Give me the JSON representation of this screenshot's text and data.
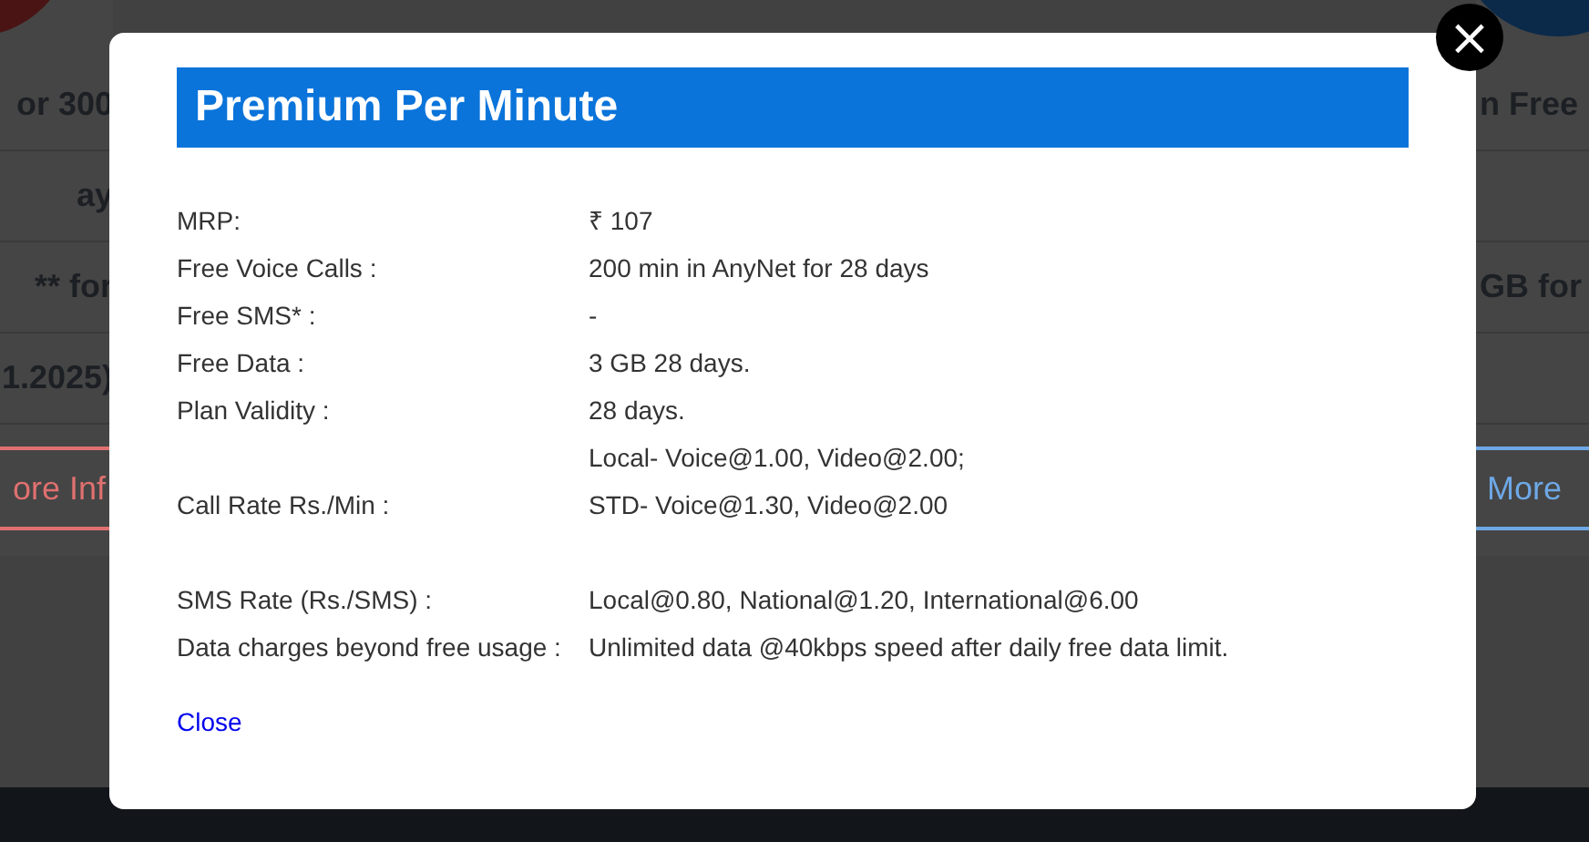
{
  "background": {
    "cards": [
      {
        "rows": [
          {
            "text": "or 300"
          },
          {
            "text": "ay"
          },
          {
            "text": "** for"
          },
          {
            "text": "1.2025)"
          }
        ],
        "button": "ore Inf",
        "color": "#4a1414"
      },
      {
        "rows": [
          {
            "text": "n Free"
          },
          {},
          {
            "text": "GB for"
          },
          {}
        ],
        "button": "More",
        "color": "#0b2a4a"
      }
    ]
  },
  "modal": {
    "title": "Premium Per Minute",
    "groups": [
      {
        "rows": [
          {
            "label": "MRP:",
            "values": [
              "₹ 107"
            ]
          },
          {
            "label": "Free Voice Calls :",
            "values": [
              "200 min in AnyNet for 28 days"
            ]
          },
          {
            "label": "Free SMS* :",
            "values": [
              "-"
            ]
          },
          {
            "label": "Free Data :",
            "values": [
              "3 GB 28 days."
            ]
          },
          {
            "label": "Plan Validity :",
            "values": [
              "28 days."
            ]
          },
          {
            "label": "Call Rate Rs./Min :",
            "values": [
              "Local- Voice@1.00, Video@2.00;",
              "STD- Voice@1.30, Video@2.00"
            ]
          }
        ]
      },
      {
        "rows": [
          {
            "label": "SMS Rate (Rs./SMS) :",
            "values": [
              "Local@0.80, National@1.20, International@6.00"
            ]
          },
          {
            "label": "Data charges beyond free usage :",
            "values": [
              "Unlimited data @40kbps speed after daily free data limit."
            ]
          }
        ]
      }
    ],
    "close_link": "Close",
    "close_button": "×"
  }
}
